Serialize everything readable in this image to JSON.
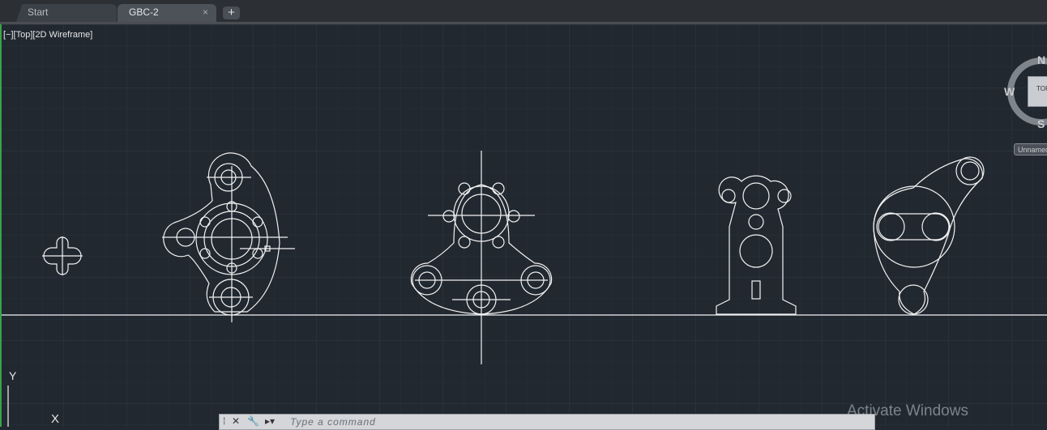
{
  "tabs": [
    {
      "label": "Start"
    },
    {
      "label": "GBC-2",
      "close": "×"
    }
  ],
  "new_tab": "+",
  "viewport_controls": "[−][Top][2D Wireframe]",
  "viewcube": {
    "north": "N",
    "west": "W",
    "south": "S",
    "face": "TOP",
    "wcs_menu": "Unnamed"
  },
  "ucs": {
    "y": "Y",
    "x": "X"
  },
  "command_line": {
    "placeholder": "Type a command"
  },
  "watermark": "Activate Windows",
  "colors": {
    "background": "#212830",
    "geometry": "#ffffff",
    "grid": "#2c3440"
  }
}
